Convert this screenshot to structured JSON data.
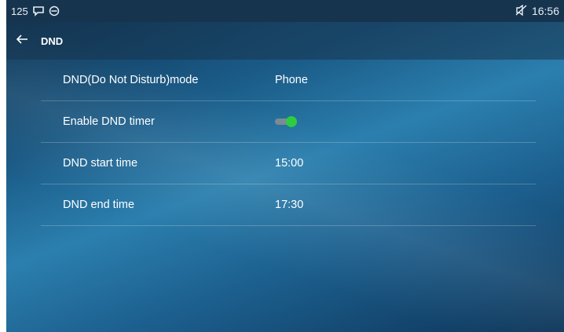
{
  "statusbar": {
    "extension": "125",
    "time": "16:56",
    "icons": [
      "voicemail-icon",
      "dnd-circle-icon",
      "mute-icon"
    ]
  },
  "header": {
    "title": "DND",
    "back_icon": "back-arrow-icon"
  },
  "settings": {
    "items": [
      {
        "label": "DND(Do Not Disturb)mode",
        "value": "Phone"
      },
      {
        "label": "Enable DND timer",
        "toggle_on": true
      },
      {
        "label": "DND start time",
        "value": "15:00"
      },
      {
        "label": "DND end time",
        "value": "17:30"
      }
    ]
  },
  "colors": {
    "toggle_on": "#2ecc40",
    "statusbar_bg": "#17344f"
  }
}
